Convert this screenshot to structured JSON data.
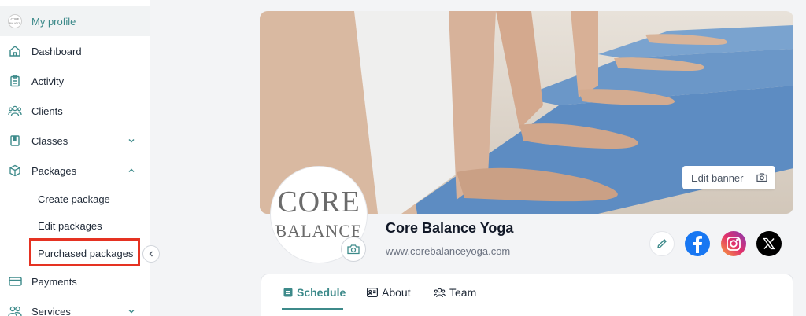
{
  "sidebar": {
    "profile": "My profile",
    "profile_logo_text": "CORE BALANCE",
    "items": {
      "dashboard": "Dashboard",
      "activity": "Activity",
      "clients": "Clients",
      "classes": "Classes",
      "packages": "Packages",
      "payments": "Payments",
      "services": "Services"
    },
    "packages_sub": {
      "create": "Create package",
      "edit": "Edit packages",
      "purchased": "Purchased packages"
    }
  },
  "profile": {
    "edit_banner": "Edit banner",
    "logo_line1": "CORE",
    "logo_line2": "BALANCE",
    "studio_name": "Core Balance Yoga",
    "website": "www.corebalanceyoga.com"
  },
  "tabs": {
    "schedule": "Schedule",
    "about": "About",
    "team": "Team"
  },
  "colors": {
    "accent": "#3d8a8a",
    "highlight": "#e53222",
    "facebook": "#1877f2"
  },
  "icons": [
    "home-icon",
    "clipboard-icon",
    "clients-icon",
    "book-icon",
    "box-icon",
    "card-icon",
    "users-icon",
    "camera-icon",
    "pencil-icon",
    "facebook-icon",
    "instagram-icon",
    "x-icon"
  ]
}
